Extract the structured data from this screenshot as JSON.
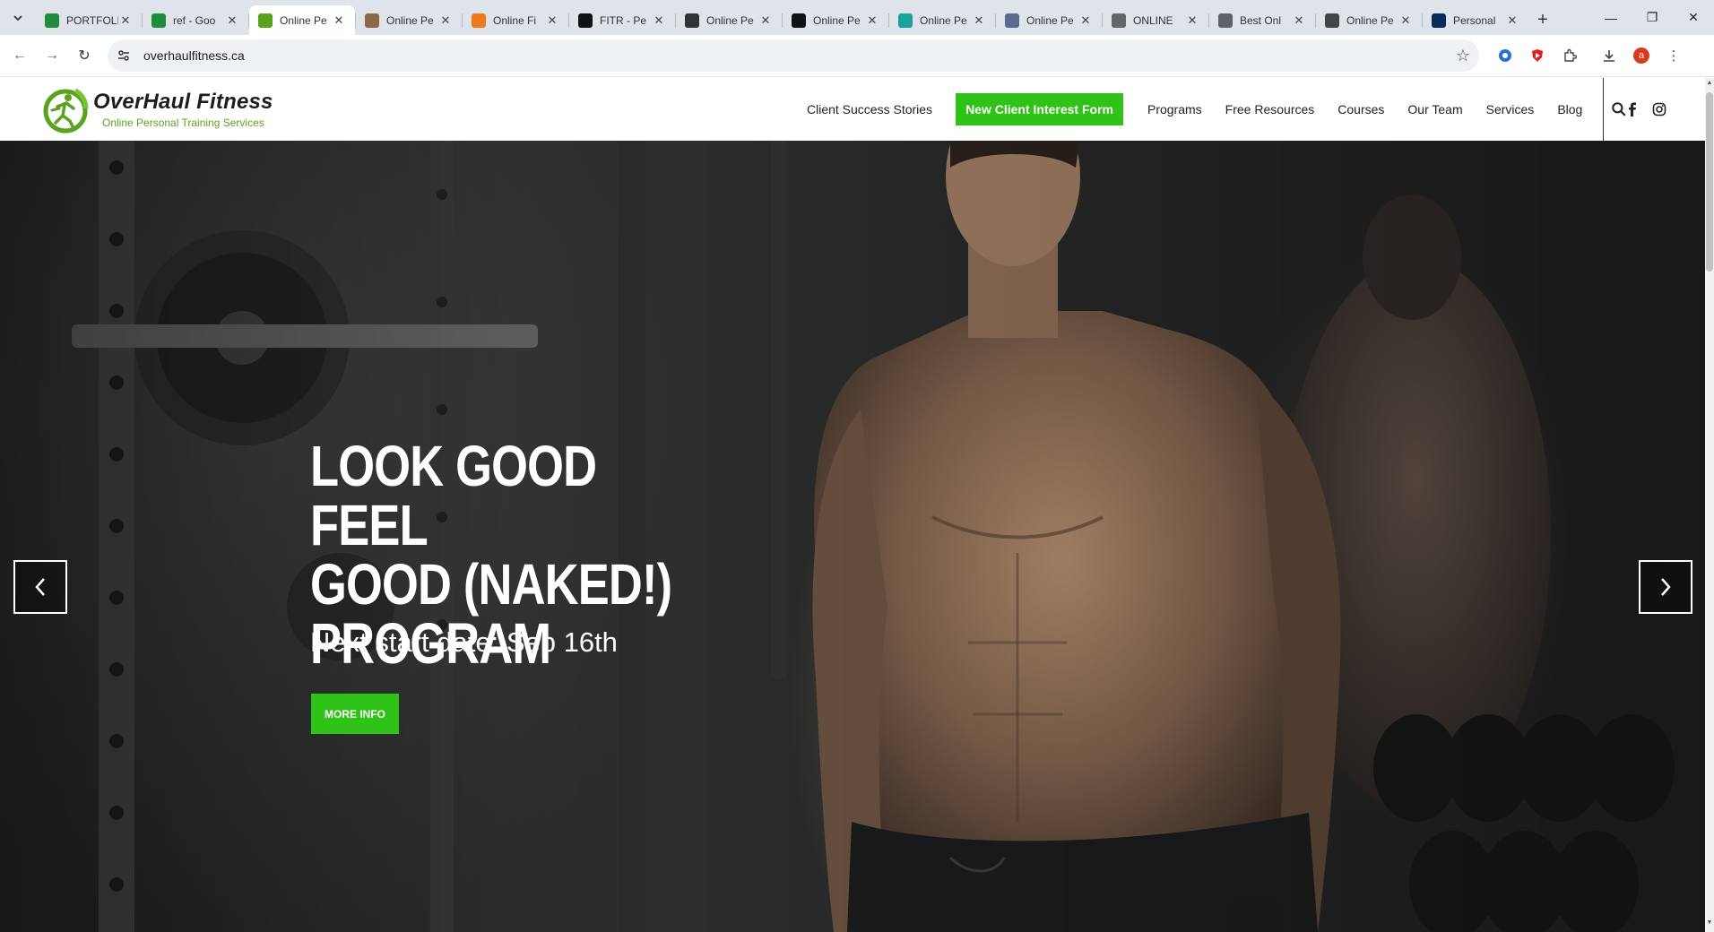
{
  "browser": {
    "tabs": [
      {
        "title": "PORTFOLIO",
        "favicon": "google-sheets-icon",
        "color": "#1e8e3e"
      },
      {
        "title": "ref - Goo",
        "favicon": "google-sheets-icon",
        "color": "#1e8e3e"
      },
      {
        "title": "Online Pe",
        "favicon": "overhaul-icon",
        "color": "#5aa31f",
        "active": true
      },
      {
        "title": "Online Pe",
        "favicon": "site-icon",
        "color": "#8a6a4a"
      },
      {
        "title": "Online Fi",
        "favicon": "flame-icon",
        "color": "#f07a1a"
      },
      {
        "title": "FITR - Pe",
        "favicon": "fitr-icon",
        "color": "#111111"
      },
      {
        "title": "Online Pe",
        "favicon": "cube-icon",
        "color": "#333333"
      },
      {
        "title": "Online Pe",
        "favicon": "k-icon",
        "color": "#111111"
      },
      {
        "title": "Online Pe",
        "favicon": "leaf-icon",
        "color": "#1aa39a"
      },
      {
        "title": "Online Pe",
        "favicon": "globe-icon",
        "color": "#5a6b8c"
      },
      {
        "title": "ONLINE",
        "favicon": "x-circle-icon",
        "color": "#666666"
      },
      {
        "title": "Best Onl",
        "favicon": "globe-icon",
        "color": "#5f6368"
      },
      {
        "title": "Online Pe",
        "favicon": "mountain-icon",
        "color": "#444444"
      },
      {
        "title": "Personal",
        "favicon": "fs-icon",
        "color": "#0a2a5c"
      }
    ],
    "url": "overhaulfitness.ca",
    "profile_initial": "a"
  },
  "site": {
    "logo_name": "OverHaul Fitness",
    "logo_tagline": "Online Personal Training Services",
    "nav": [
      {
        "label": "Client Success Stories"
      },
      {
        "label": "New Client Interest Form",
        "cta": true
      },
      {
        "label": "Programs"
      },
      {
        "label": "Free Resources"
      },
      {
        "label": "Courses"
      },
      {
        "label": "Our Team"
      },
      {
        "label": "Services"
      },
      {
        "label": "Blog"
      }
    ],
    "colors": {
      "accent": "#2fc317",
      "logo_green": "#5aa31f"
    }
  },
  "hero": {
    "title_line1": "LOOK GOOD FEEL",
    "title_line2": "GOOD (NAKED!)",
    "title_line3": "PROGRAM",
    "subtitle": "Next start date: Sep 16th",
    "button": "MORE INFO"
  }
}
